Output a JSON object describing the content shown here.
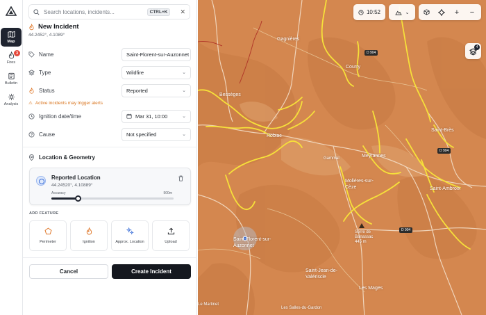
{
  "rail": {
    "items": [
      {
        "label": "Map",
        "icon": "map-icon",
        "active": true
      },
      {
        "label": "Fires",
        "icon": "flame-icon",
        "badge": "3"
      },
      {
        "label": "Bulletin",
        "icon": "bulletin-icon"
      },
      {
        "label": "Analysis",
        "icon": "analysis-icon"
      }
    ]
  },
  "search": {
    "placeholder": "Search locations, incidents...",
    "shortcut": "CTRL+K"
  },
  "incident": {
    "title": "New Incident",
    "coords": "44.2452°, 4.1089°"
  },
  "form": {
    "name_label": "Name",
    "name_value": "Saint-Florent-sur-Auzonnet",
    "type_label": "Type",
    "type_value": "Wildfire",
    "status_label": "Status",
    "status_value": "Reported",
    "status_alert": "Active incidents may trigger alerts",
    "ignition_label": "Ignition date/time",
    "ignition_value": "Mar 31, 10:00",
    "cause_label": "Cause",
    "cause_value": "Not specified"
  },
  "location": {
    "section_title": "Location & Geometry",
    "card_title": "Reported Location",
    "card_coords": "44.24520°, 4.10889°",
    "accuracy_label": "Accuracy",
    "accuracy_value": "500m",
    "accuracy_fraction": 0.22
  },
  "add_feature": {
    "label": "ADD FEATURE",
    "items": [
      {
        "label": "Perimeter",
        "icon": "pentagon-icon"
      },
      {
        "label": "Ignition",
        "icon": "flame-icon"
      },
      {
        "label": "Approx. Location",
        "icon": "sparkle-icon"
      },
      {
        "label": "Upload",
        "icon": "upload-icon"
      }
    ]
  },
  "actions": {
    "cancel": "Cancel",
    "create": "Create Incident"
  },
  "map": {
    "time": "10:52",
    "layers_count": "4",
    "accent": "#d4874f",
    "places": [
      {
        "name": "Gagnières"
      },
      {
        "name": "Courry"
      },
      {
        "name": "Bessèges"
      },
      {
        "name": "Robiac"
      },
      {
        "name": "Saint-Brès"
      },
      {
        "name": "Meyrannes"
      },
      {
        "name": "Gammal"
      },
      {
        "name": "Molières-sur-Cèze"
      },
      {
        "name": "Saint-Ambroix"
      },
      {
        "name": "Serre de Banassac 445 m"
      },
      {
        "name": "Saint-Florent-sur-Auzonnet"
      },
      {
        "name": "Saint-Jean-de-Valériscle"
      },
      {
        "name": "Les Mages"
      },
      {
        "name": "Le Martinet"
      },
      {
        "name": "Les Salles-du-Gardon"
      }
    ],
    "roads": [
      "D 904",
      "D 904",
      "D 904"
    ]
  }
}
